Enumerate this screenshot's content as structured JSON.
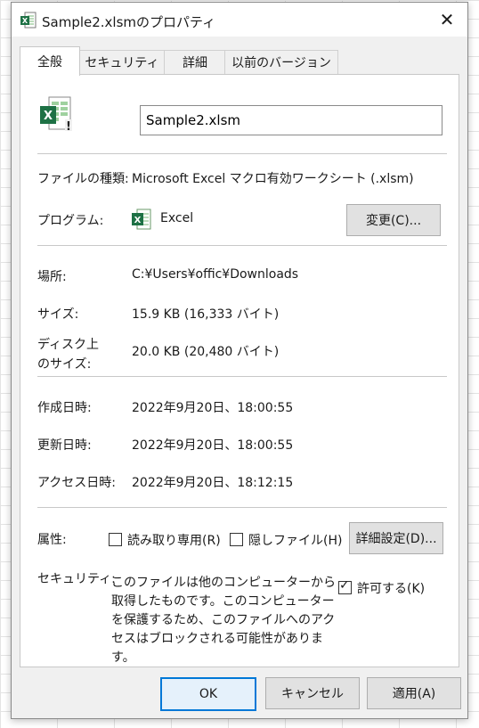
{
  "window": {
    "title": "Sample2.xlsmのプロパティ",
    "close_glyph": "✕"
  },
  "tabs": [
    {
      "label": "全般"
    },
    {
      "label": "セキュリティ"
    },
    {
      "label": "詳細"
    },
    {
      "label": "以前のバージョン"
    }
  ],
  "file": {
    "name": "Sample2.xlsm",
    "icon": "excel-macro-file-icon"
  },
  "type_row": {
    "label": "ファイルの種類:",
    "value": "Microsoft Excel マクロ有効ワークシート (.xlsm)"
  },
  "program_row": {
    "label": "プログラム:",
    "app_icon": "excel-icon",
    "value": "Excel",
    "change_button": "変更(C)..."
  },
  "location_row": {
    "label": "場所:",
    "value": "C:¥Users¥offic¥Downloads"
  },
  "size_row": {
    "label": "サイズ:",
    "value": "15.9 KB (16,333 バイト)"
  },
  "disk_size_row": {
    "label_line1": "ディスク上",
    "label_line2": "のサイズ:",
    "value": "20.0 KB (20,480 バイト)"
  },
  "created_row": {
    "label": "作成日時:",
    "value": "2022年9月20日、18:00:55"
  },
  "modified_row": {
    "label": "更新日時:",
    "value": "2022年9月20日、18:00:55"
  },
  "accessed_row": {
    "label": "アクセス日時:",
    "value": "2022年9月20日、18:12:15"
  },
  "attributes": {
    "label": "属性:",
    "readonly_label": "読み取り専用(R)",
    "readonly_checked": false,
    "hidden_label": "隠しファイル(H)",
    "hidden_checked": false,
    "advanced_button": "詳細設定(D)..."
  },
  "security": {
    "label": "セキュリティ:",
    "text": "このファイルは他のコンピューターから取得したものです。このコンピューターを保護するため、このファイルへのアクセスはブロックされる可能性があります。",
    "unblock_label": "許可する(K)",
    "unblock_checked": true
  },
  "footer": {
    "ok": "OK",
    "cancel": "キャンセル",
    "apply": "適用(A)"
  },
  "colors": {
    "excel_green": "#1e7145",
    "focus_blue": "#0078d7"
  }
}
